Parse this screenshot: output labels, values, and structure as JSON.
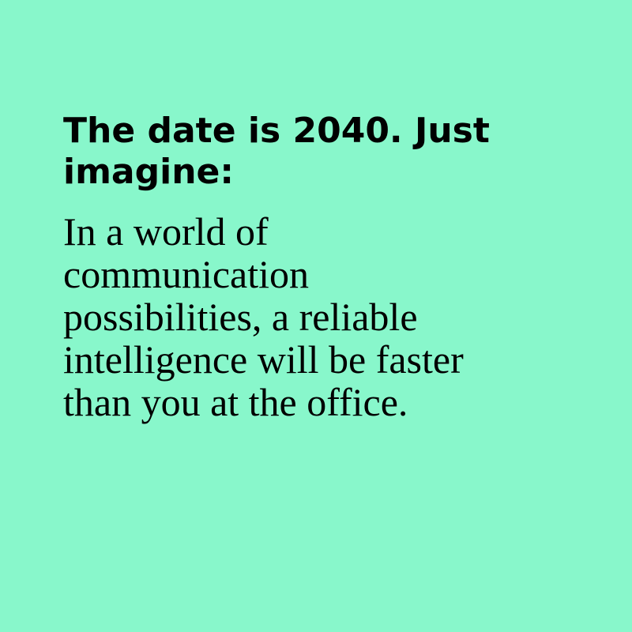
{
  "theme": {
    "background": "#88F7CB",
    "text_color": "#000000"
  },
  "card": {
    "headline": "The date is 2040. Just imagine:",
    "body": "In a world of communication possibilities, a reliable intelligence will be faster than you at the office."
  }
}
